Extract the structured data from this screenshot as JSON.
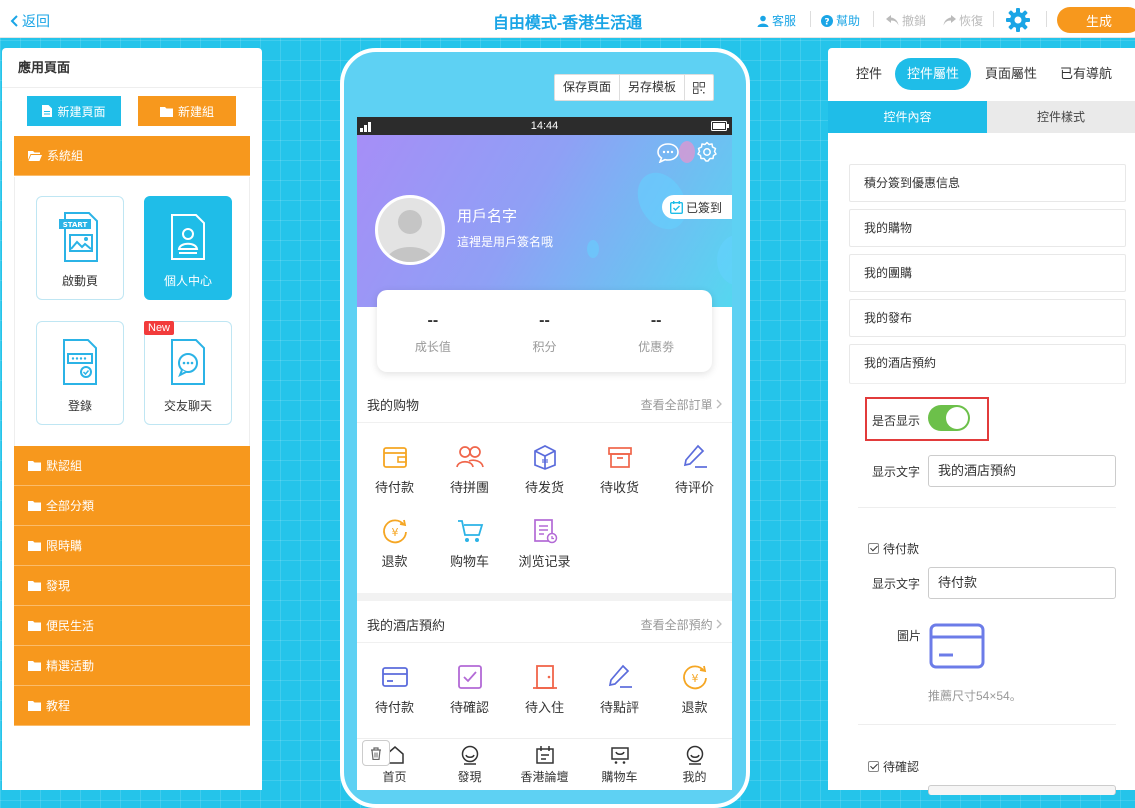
{
  "topbar": {
    "back": "返回",
    "title": "自由模式-香港生活通",
    "service": "客服",
    "help": "幫助",
    "undo": "撤銷",
    "redo": "恢復",
    "generate": "生成"
  },
  "left": {
    "header": "應用頁面",
    "new_page": "新建頁面",
    "new_group": "新建組",
    "group_open": "系統組",
    "cards": [
      {
        "label": "啟動頁"
      },
      {
        "label": "個人中心"
      },
      {
        "label": "登錄"
      },
      {
        "label": "交友聊天",
        "badge": "New"
      }
    ],
    "icon_start_text": "START",
    "groups": [
      "默認組",
      "全部分類",
      "限時購",
      "發現",
      "便民生活",
      "精選活動",
      "教程"
    ]
  },
  "phone": {
    "tool": [
      "保存頁面",
      "另存模板"
    ],
    "time": "14:44",
    "username": "用戶名字",
    "signature": "這裡是用戶簽名哦",
    "signed": "已簽到",
    "stats": [
      {
        "value": "--",
        "label": "成长值"
      },
      {
        "value": "--",
        "label": "积分"
      },
      {
        "value": "--",
        "label": "优惠劵"
      }
    ],
    "shop": {
      "title": "我的购物",
      "more": "查看全部訂單",
      "items": [
        "待付款",
        "待拼團",
        "待发货",
        "待收货",
        "待评价",
        "退款",
        "购物车",
        "浏览记录"
      ]
    },
    "hotel": {
      "title": "我的酒店預約",
      "more": "查看全部預約",
      "items": [
        "待付款",
        "待確認",
        "待入住",
        "待點評",
        "退款"
      ]
    },
    "tabs": [
      "首页",
      "發現",
      "香港論壇",
      "購物车",
      "我的"
    ]
  },
  "right": {
    "tabs": [
      "控件",
      "控件屬性",
      "頁面屬性",
      "已有導航"
    ],
    "subtabs": [
      "控件內容",
      "控件樣式"
    ],
    "rows": [
      "積分簽到優惠信息",
      "我的購物",
      "我的團購",
      "我的發布",
      "我的酒店預約"
    ],
    "show_label": "是否显示",
    "show_enabled": true,
    "text_label": "显示文字",
    "text_value": "我的酒店預約",
    "check1": "待付款",
    "text_label2": "显示文字",
    "text_value2": "待付款",
    "image_label": "圖片",
    "hint": "推薦尺寸54×54。",
    "check2": "待確認"
  },
  "colors": {
    "accent": "#1fbde8",
    "orange": "#f7981d",
    "canvas": "#25c4ea",
    "toggle": "#6cc04a",
    "highlight": "#e23b3b"
  }
}
